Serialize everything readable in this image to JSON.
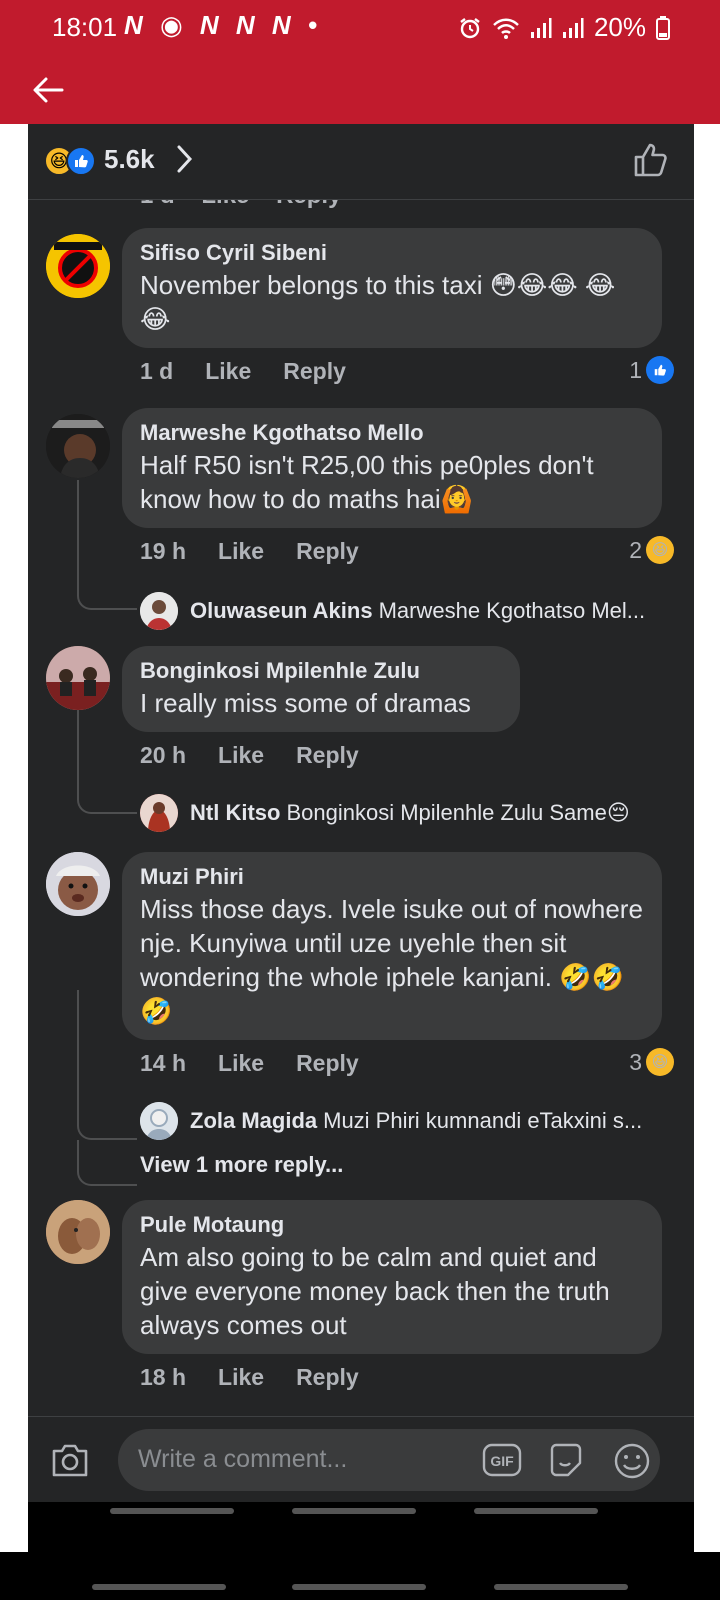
{
  "status_bar": {
    "time": "18:01",
    "notif_icons": "N ◉ N N N •",
    "battery": "20%",
    "bg_color": "#c11b2d"
  },
  "reactions": {
    "count": "5.6k",
    "icons": [
      "haha-icon",
      "like-icon"
    ]
  },
  "cut_row": {
    "time": "1 d",
    "like": "Like",
    "reply": "Reply"
  },
  "comments": [
    {
      "author": "Sifiso Cyril Sibeni",
      "text": "November belongs to this taxi 😳😂😂 😂😂",
      "time": "1 d",
      "like": "Like",
      "reply": "Reply",
      "reactions": "1",
      "reaction_icon": "like-icon"
    },
    {
      "author": "Marweshe Kgothatso Mello",
      "text": "Half R50 isn't R25,00 this pe0ples don't know how to do maths hai🙆",
      "time": "19 h",
      "like": "Like",
      "reply": "Reply",
      "reactions": "2",
      "reaction_icon": "haha-icon",
      "reply_preview": {
        "author": "Oluwaseun Akins",
        "text": "Marweshe Kgothatso Mel..."
      }
    },
    {
      "author": "Bonginkosi Mpilenhle Zulu",
      "text": "I really miss some of dramas",
      "time": "20 h",
      "like": "Like",
      "reply": "Reply",
      "reply_preview": {
        "author": "Ntl Kitso",
        "text": "Bonginkosi Mpilenhle Zulu Same😔"
      }
    },
    {
      "author": "Muzi Phiri",
      "text": "Miss those days. Ivele isuke out of nowhere nje. Kunyiwa until uze uyehle then sit wondering the whole iphele kanjani. 🤣🤣🤣",
      "time": "14 h",
      "like": "Like",
      "reply": "Reply",
      "reactions": "3",
      "reaction_icon": "haha-icon",
      "reply_preview": {
        "author": "Zola Magida",
        "text": "Muzi Phiri kumnandi eTakxini s..."
      },
      "view_more": "View 1 more reply..."
    },
    {
      "author": "Pule Motaung",
      "text": "Am also going to be calm and quiet and give everyone money back then the truth always comes out",
      "time": "18 h",
      "like": "Like",
      "reply": "Reply"
    }
  ],
  "composer": {
    "placeholder": "Write a comment...",
    "gif_label": "GIF"
  }
}
